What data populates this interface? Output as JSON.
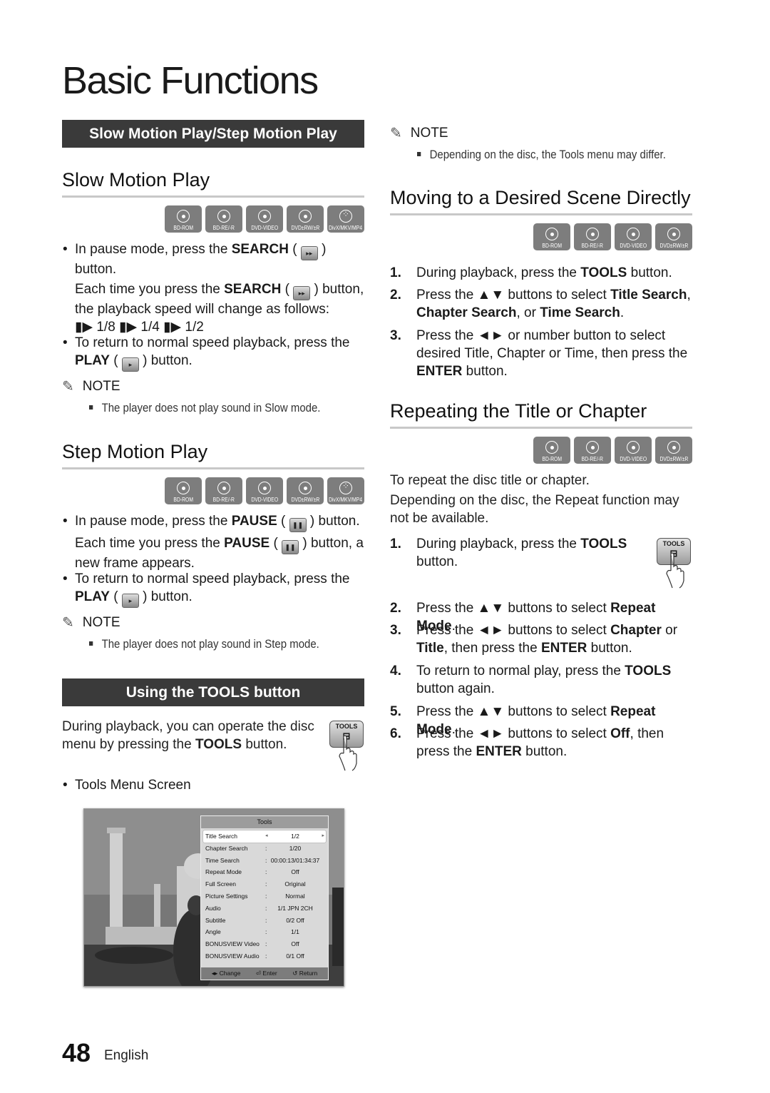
{
  "page": {
    "title": "Basic Functions",
    "page_number": "48",
    "language": "English"
  },
  "left": {
    "banner1": "Slow Motion Play/Step Motion Play",
    "slow": {
      "heading": "Slow Motion Play",
      "badges": [
        "BD-ROM",
        "BD-RE/-R",
        "DVD-VIDEO",
        "DVD±RW/±R",
        "DivX/MKV/MP4"
      ],
      "b1_pre": "In pause mode, press the ",
      "b1_bold": "SEARCH",
      "b1_open": " ( ",
      "b1_post": " )",
      "b1_line2": "button.",
      "b1_p2_pre": "Each time you press the ",
      "b1_p2_bold": "SEARCH",
      "b1_p2_post": " ) button,",
      "b1_p2_line2": "the playback speed will change as follows:",
      "speeds": "▮▶ 1/8 ▮▶ 1/4 ▮▶ 1/2",
      "b2_line1": "To return to normal speed playback, press the",
      "b2_bold": "PLAY",
      "b2_post": " ) button.",
      "note_label": "NOTE",
      "note": "The player does not play sound in Slow mode."
    },
    "step": {
      "heading": "Step Motion Play",
      "badges": [
        "BD-ROM",
        "BD-RE/-R",
        "DVD-VIDEO",
        "DVD±RW/±R",
        "DivX/MKV/MP4"
      ],
      "b1_pre": "In pause mode, press the ",
      "b1_bold": "PAUSE",
      "b1_post": " ) button.",
      "b1_p2_pre": "Each time you press the ",
      "b1_p2_bold": "PAUSE",
      "b1_p2_post": " ) button, a",
      "b1_p2_line2": "new frame appears.",
      "b2_line1": "To return to normal speed playback, press the",
      "b2_bold": "PLAY",
      "b2_post": " ) button.",
      "note_label": "NOTE",
      "note": "The player does not play sound in Step mode."
    },
    "banner2": "Using the TOOLS button",
    "tools_intro_line1": "During playback, you can operate the disc",
    "tools_intro_pre": "menu by pressing the ",
    "tools_intro_bold": "TOOLS",
    "tools_intro_post": " button.",
    "tools_key_label": "TOOLS",
    "tools_menu_bullet": "Tools Menu Screen",
    "tools_menu": {
      "title": "Tools",
      "rows": [
        {
          "label": "Title Search",
          "value": "1/2",
          "selected": true
        },
        {
          "label": "Chapter Search",
          "value": "1/20"
        },
        {
          "label": "Time Search",
          "value": "00:00:13/01:34:37"
        },
        {
          "label": "Repeat Mode",
          "value": "Off"
        },
        {
          "label": "Full Screen",
          "value": "Original"
        },
        {
          "label": "Picture Settings",
          "value": "Normal"
        },
        {
          "label": "Audio",
          "value": "1/1 JPN 2CH"
        },
        {
          "label": "Subtitle",
          "value": "0/2 Off"
        },
        {
          "label": "Angle",
          "value": "1/1"
        },
        {
          "label": "BONUSVIEW Video",
          "value": "Off"
        },
        {
          "label": "BONUSVIEW Audio",
          "value": "0/1 Off"
        }
      ],
      "footer": [
        "◂▸ Change",
        "⏎ Enter",
        "↺ Return"
      ]
    }
  },
  "right": {
    "note_label": "NOTE",
    "note": "Depending on the disc, the Tools menu may differ.",
    "moving": {
      "heading": "Moving to a Desired Scene Directly",
      "badges": [
        "BD-ROM",
        "BD-RE/-R",
        "DVD-VIDEO",
        "DVD±RW/±R"
      ],
      "steps": [
        {
          "num": "1.",
          "pre": "During playback, press the ",
          "bold": "TOOLS",
          "post": " button."
        },
        {
          "num": "2.",
          "line1_pre": "Press the ▲▼ buttons to select ",
          "line1_bold": "Title Search",
          "line1_post": ",",
          "line2_bold1": "Chapter Search",
          "line2_mid": ", or ",
          "line2_bold2": "Time Search",
          "line2_post": "."
        },
        {
          "num": "3.",
          "line1": "Press the ◄► or number button to select",
          "line2": "desired Title, Chapter or Time, then press the",
          "line3_bold": "ENTER",
          "line3_post": " button."
        }
      ]
    },
    "repeat": {
      "heading": "Repeating the Title or Chapter",
      "badges": [
        "BD-ROM",
        "BD-RE/-R",
        "DVD-VIDEO",
        "DVD±RW/±R"
      ],
      "intro1": "To repeat the disc title or chapter.",
      "intro2_line1": "Depending on the disc, the Repeat function may",
      "intro2_line2": "not be available.",
      "tools_key_label": "TOOLS",
      "steps": [
        {
          "num": "1.",
          "pre": "During playback, press the ",
          "bold": "TOOLS",
          "line2": "button."
        },
        {
          "num": "2.",
          "pre": "Press the ▲▼ buttons to select ",
          "bold": "Repeat Mode",
          "post": "."
        },
        {
          "num": "3.",
          "pre": "Press the ◄► buttons to select ",
          "bold": "Chapter",
          "post": " or",
          "line2_bold": "Title",
          "line2_mid": ", then press the ",
          "line2_bold2": "ENTER",
          "line2_post": " button."
        },
        {
          "num": "4.",
          "pre": "To return to normal play, press the ",
          "bold": "TOOLS",
          "line2": "button again."
        },
        {
          "num": "5.",
          "pre": "Press the ▲▼ buttons to select ",
          "bold": "Repeat Mode",
          "post": "."
        },
        {
          "num": "6.",
          "pre": "Press the ◄► buttons to select ",
          "bold": "Off",
          "post": ", then",
          "line2_pre": "press the ",
          "line2_bold": "ENTER",
          "line2_post": " button."
        }
      ]
    }
  },
  "icons": {
    "search_button": "▸▸",
    "play_button": "▸",
    "pause_button": "❚❚",
    "note_pencil": "✎"
  }
}
